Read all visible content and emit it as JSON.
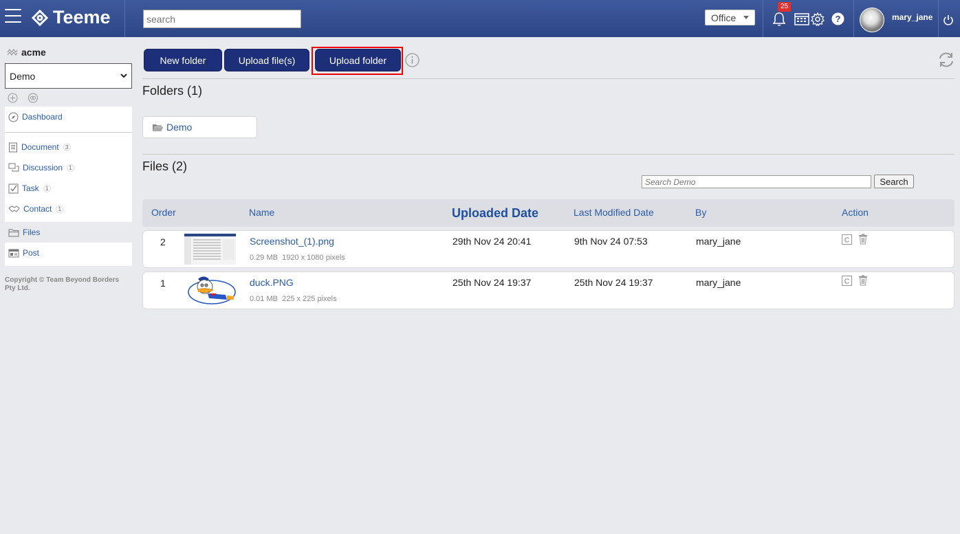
{
  "app": {
    "name": "Teeme"
  },
  "topbar": {
    "search_placeholder": "search",
    "office_label": "Office",
    "notification_count": "25",
    "username": "mary_jane"
  },
  "sidebar": {
    "org_name": "acme",
    "project_selected": "Demo",
    "items": [
      {
        "label": "Dashboard",
        "icon": "compass-icon",
        "count": ""
      },
      {
        "label": "Document",
        "icon": "document-icon",
        "count": "3"
      },
      {
        "label": "Discussion",
        "icon": "discussion-icon",
        "count": "1"
      },
      {
        "label": "Task",
        "icon": "checkbox-icon",
        "count": "1"
      },
      {
        "label": "Contact",
        "icon": "handshake-icon",
        "count": "1"
      },
      {
        "label": "Files",
        "icon": "folder-icon",
        "count": ""
      },
      {
        "label": "Post",
        "icon": "post-icon",
        "count": ""
      }
    ],
    "copyright_line1": "Copyright © Team Beyond Borders",
    "copyright_line2": "Pty Ltd."
  },
  "toolbar": {
    "new_folder": "New folder",
    "upload_files": "Upload file(s)",
    "upload_folder": "Upload folder"
  },
  "folders": {
    "title": "Folders (1)",
    "items": [
      {
        "name": "Demo"
      }
    ]
  },
  "files": {
    "title": "Files (2)",
    "search_placeholder": "Search Demo",
    "search_button": "Search",
    "columns": {
      "order": "Order",
      "name": "Name",
      "uploaded": "Uploaded Date",
      "modified": "Last Modified Date",
      "by": "By",
      "action": "Action"
    },
    "rows": [
      {
        "order": "2",
        "name": "Screenshot_(1).png",
        "size": "0.29 MB",
        "dims": "1920 x 1080 pixels",
        "uploaded": "29th Nov 24 20:41",
        "modified": "9th Nov 24 07:53",
        "by": "mary_jane"
      },
      {
        "order": "1",
        "name": "duck.PNG",
        "size": "0.01 MB",
        "dims": "225 x 225 pixels",
        "uploaded": "25th Nov 24 19:37",
        "modified": "25th Nov 24 19:37",
        "by": "mary_jane"
      }
    ]
  },
  "colors": {
    "topbar": "#2c4585",
    "button": "#1e2f7a",
    "link": "#2b5ba8",
    "highlight": "#e00000"
  }
}
